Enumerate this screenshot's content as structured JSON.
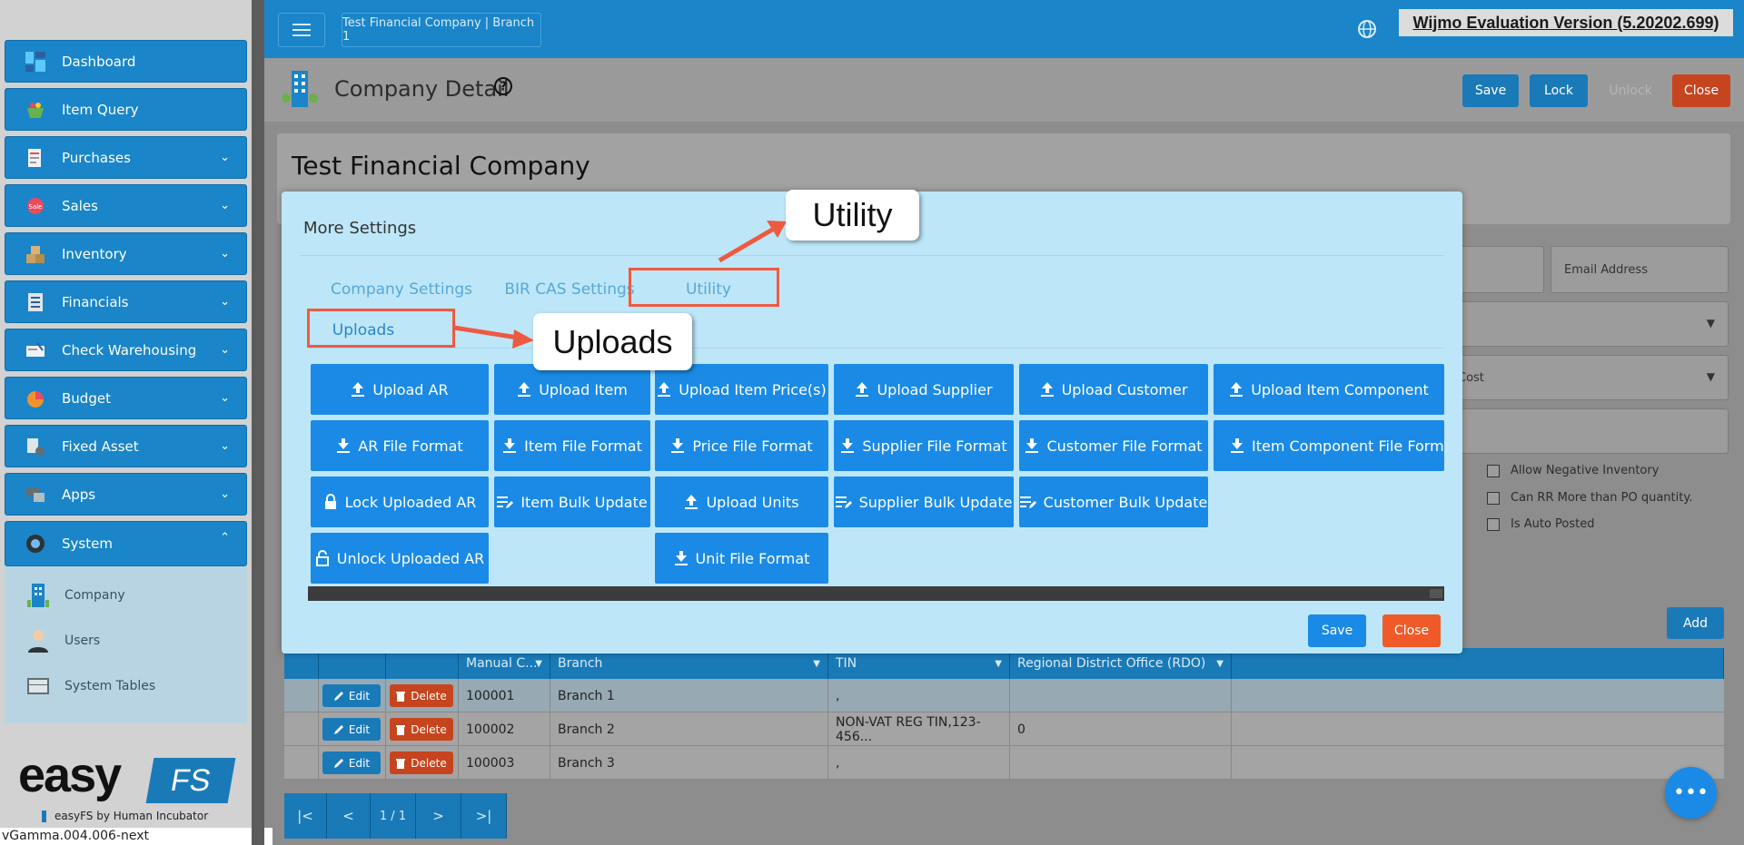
{
  "sidebar": {
    "items": [
      {
        "label": "Dashboard",
        "icon": "dashboard-icon",
        "expandable": false
      },
      {
        "label": "Item Query",
        "icon": "basket-icon",
        "expandable": false
      },
      {
        "label": "Purchases",
        "icon": "receipt-icon",
        "expandable": true
      },
      {
        "label": "Sales",
        "icon": "sale-tag-icon",
        "expandable": true
      },
      {
        "label": "Inventory",
        "icon": "boxes-icon",
        "expandable": true
      },
      {
        "label": "Financials",
        "icon": "ledger-icon",
        "expandable": true
      },
      {
        "label": "Check Warehousing",
        "icon": "check-icon",
        "expandable": true
      },
      {
        "label": "Budget",
        "icon": "budget-icon",
        "expandable": true
      },
      {
        "label": "Fixed Asset",
        "icon": "asset-icon",
        "expandable": true
      },
      {
        "label": "Apps",
        "icon": "apps-icon",
        "expandable": true
      },
      {
        "label": "System",
        "icon": "gear-icon",
        "expandable": true,
        "expanded": true
      }
    ],
    "subitems": [
      {
        "label": "Company",
        "icon": "building-icon"
      },
      {
        "label": "Users",
        "icon": "user-icon"
      },
      {
        "label": "System Tables",
        "icon": "table-icon"
      }
    ],
    "logo": {
      "word": "easy",
      "fs": "FS",
      "tagline": "easyFS by Human Incubator"
    },
    "version": "vGamma.004.006-next"
  },
  "topbar": {
    "company_branch": "Test Financial Company | Branch 1",
    "wijmo_notice": "Wijmo Evaluation Version (5.20202.699)"
  },
  "header": {
    "title": "Company Detail",
    "help_icon": "help-circle-icon",
    "buttons": {
      "save": "Save",
      "lock": "Lock",
      "unlock": "Unlock",
      "close": "Close"
    }
  },
  "company": {
    "name": "Test Financial Company",
    "email_placeholder": "Email Address",
    "cost_partial": "Cost",
    "checkboxes": [
      "Allow Negative Inventory",
      "Can RR More than PO quantity.",
      "Is Auto Posted"
    ]
  },
  "grid": {
    "add_label": "Add",
    "columns": [
      "Manual C...",
      "Branch",
      "TIN",
      "Regional District Office (RDO)"
    ],
    "edit_label": "Edit",
    "delete_label": "Delete",
    "rows": [
      {
        "manual": "100001",
        "branch": "Branch 1",
        "tin": ",",
        "rdo": ""
      },
      {
        "manual": "100002",
        "branch": "Branch 2",
        "tin": "NON-VAT REG TIN,123-456...",
        "rdo": "0"
      },
      {
        "manual": "100003",
        "branch": "Branch 3",
        "tin": ",",
        "rdo": ""
      }
    ],
    "pager": {
      "first": "|<",
      "prev": "<",
      "page": "1 / 1",
      "next": ">",
      "last": ">|"
    }
  },
  "modal": {
    "title": "More Settings",
    "tabs": [
      "Company Settings",
      "BIR CAS Settings",
      "Utility"
    ],
    "subtab": "Uploads",
    "buttons": [
      [
        "Upload AR",
        "Upload Item",
        "Upload Item Price(s)",
        "Upload Supplier",
        "Upload Customer",
        "Upload Item Component"
      ],
      [
        "AR File Format",
        "Item File Format",
        "Price File Format",
        "Supplier File Format",
        "Customer File Format",
        "Item Component File Format"
      ],
      [
        "Lock Uploaded AR",
        "Item Bulk Update",
        "Upload Units",
        "Supplier Bulk Update",
        "Customer Bulk Update"
      ],
      [
        "Unlock Uploaded AR",
        "Unit File Format"
      ]
    ],
    "save": "Save",
    "close": "Close"
  },
  "callouts": {
    "utility": "Utility",
    "uploads": "Uploads"
  },
  "colors": {
    "primary": "#1a8ae6",
    "danger": "#f05a28",
    "modal_bg": "#bde7f8",
    "annotation": "#ee5a40"
  }
}
